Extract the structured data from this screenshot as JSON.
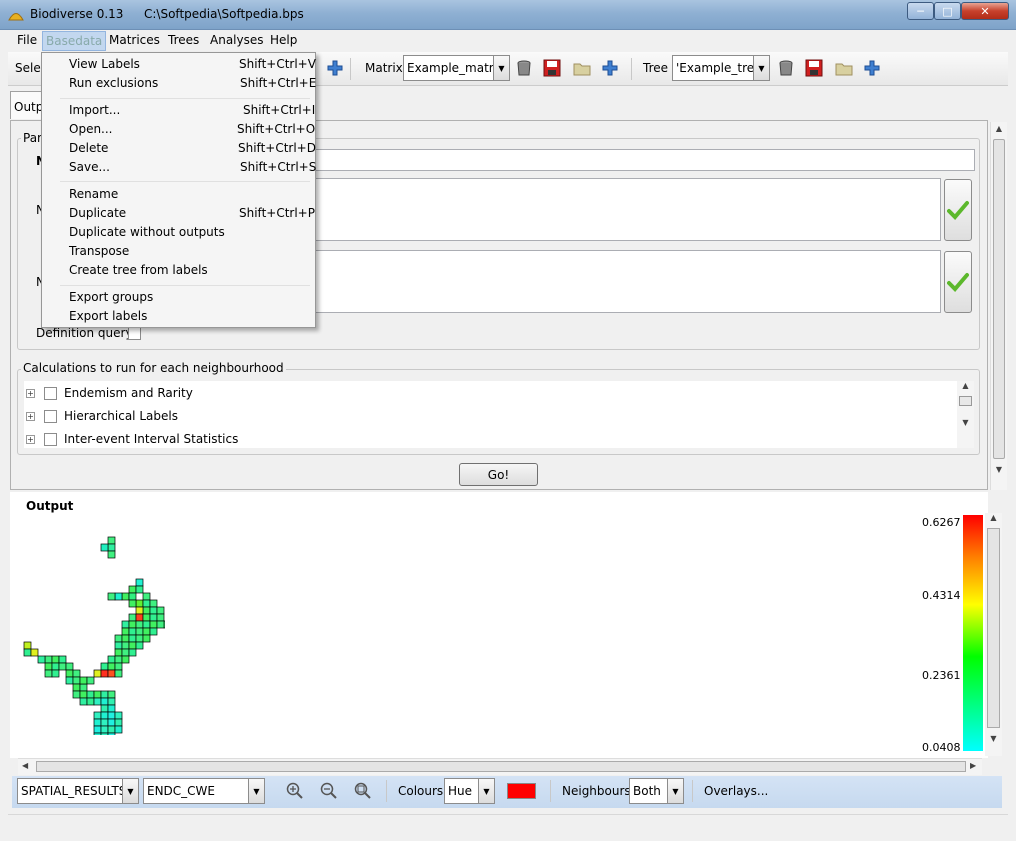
{
  "window": {
    "title": "Biodiverse 0.13",
    "path": "C:\\Softpedia\\Softpedia.bps",
    "min": "─",
    "max": "□",
    "close": "✕"
  },
  "menu": [
    {
      "label": "File"
    },
    {
      "label": "Basedata"
    },
    {
      "label": "Matrices"
    },
    {
      "label": "Trees"
    },
    {
      "label": "Analyses"
    },
    {
      "label": "Help"
    }
  ],
  "toolbar": {
    "select_label": "Selec",
    "matrix_label": "Matrix",
    "matrix_value": "Example_matrix",
    "tree_label": "Tree",
    "tree_value": "'Example_tree'"
  },
  "tabs": {
    "output_label": "Outp"
  },
  "params": {
    "legend": "Para",
    "n1": "N",
    "n2": "N",
    "n3": "N"
  },
  "definition_query_label": "Definition query",
  "calculations": {
    "legend": "Calculations to run for each neighbourhood",
    "items": [
      "Endemism and Rarity",
      "Hierarchical Labels",
      "Inter-event Interval Statistics"
    ]
  },
  "go_label": "Go!",
  "output": {
    "label": "Output",
    "legend_values": [
      "0.6267",
      "0.4314",
      "0.2361",
      "0.0408"
    ]
  },
  "bottom": {
    "result_list": "SPATIAL_RESULTS",
    "index": "ENDC_CWE",
    "colours_label": "Colours",
    "colours_value": "Hue",
    "colour_swatch": "#ff0000",
    "neighbours_label": "Neighbours",
    "neighbours_value": "Both",
    "overlays_label": "Overlays..."
  },
  "dropdown": [
    {
      "label": "View Labels",
      "shortcut": "Shift+Ctrl+V"
    },
    {
      "label": "Run exclusions",
      "shortcut": "Shift+Ctrl+E"
    },
    {
      "label": "Import...",
      "shortcut": "Shift+Ctrl+I"
    },
    {
      "label": "Open...",
      "shortcut": "Shift+Ctrl+O"
    },
    {
      "label": "Delete",
      "shortcut": "Shift+Ctrl+D"
    },
    {
      "label": "Save...",
      "shortcut": "Shift+Ctrl+S"
    },
    {
      "label": "Rename",
      "shortcut": ""
    },
    {
      "label": "Duplicate",
      "shortcut": "Shift+Ctrl+P"
    },
    {
      "label": "Duplicate without outputs",
      "shortcut": ""
    },
    {
      "label": "Transpose",
      "shortcut": ""
    },
    {
      "label": "Create tree from labels",
      "shortcut": ""
    },
    {
      "label": "Export groups",
      "shortcut": ""
    },
    {
      "label": "Export labels",
      "shortcut": ""
    }
  ]
}
